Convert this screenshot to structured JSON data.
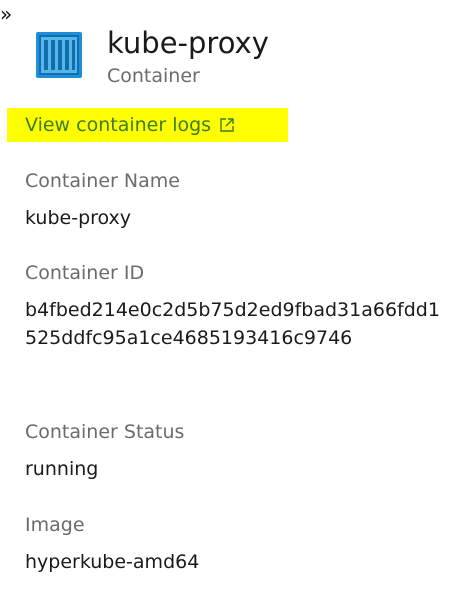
{
  "collapse_glyph": "»",
  "header": {
    "icon": "container-icon",
    "title": "kube-proxy",
    "subtitle": "Container"
  },
  "logs_link": {
    "label": "View container logs",
    "icon": "external-link-icon",
    "highlight_color": "#ffff00",
    "text_color": "#3a7d26"
  },
  "fields": {
    "name": {
      "label": "Container Name",
      "value": "kube-proxy"
    },
    "id": {
      "label": "Container ID",
      "value": "b4fbed214e0c2d5b75d2ed9fbad31a66fdd1525ddfc95a1ce4685193416c9746"
    },
    "status": {
      "label": "Container Status",
      "value": "running"
    },
    "image": {
      "label": "Image",
      "value": "hyperkube-amd64"
    }
  },
  "colors": {
    "label_gray": "#6b6b6b",
    "icon_blue": "#1e8fd6"
  }
}
